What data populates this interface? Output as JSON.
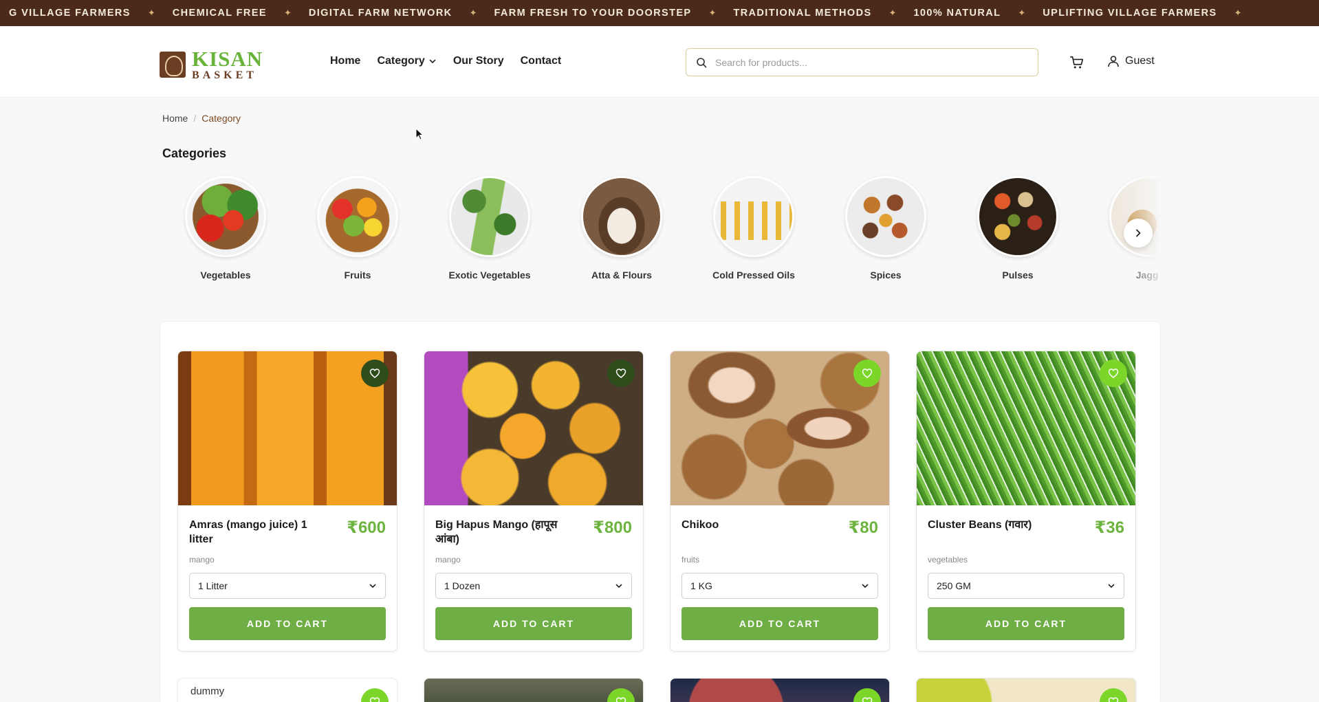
{
  "marquee": {
    "items": [
      "G VILLAGE FARMERS",
      "CHEMICAL FREE",
      "DIGITAL FARM NETWORK",
      "FARM FRESH TO YOUR DOORSTEP",
      "TRADITIONAL METHODS",
      "100% NATURAL",
      "UPLIFTING VILLAGE FARMERS"
    ],
    "separator": "✦"
  },
  "brand": {
    "line1": "KISAN",
    "line2": "BASKET"
  },
  "nav": {
    "home": "Home",
    "category": "Category",
    "story": "Our Story",
    "contact": "Contact"
  },
  "search": {
    "placeholder": "Search for products..."
  },
  "user": {
    "label": "Guest"
  },
  "breadcrumb": {
    "home": "Home",
    "sep": "/",
    "current": "Category"
  },
  "categories": {
    "title": "Categories",
    "items": [
      {
        "label": "Vegetables"
      },
      {
        "label": "Fruits"
      },
      {
        "label": "Exotic Vegetables"
      },
      {
        "label": "Atta & Flours"
      },
      {
        "label": "Cold Pressed Oils"
      },
      {
        "label": "Spices"
      },
      {
        "label": "Pulses"
      },
      {
        "label": "Jagge"
      }
    ]
  },
  "products": [
    {
      "name": "Amras (mango juice) 1 litter",
      "price": "₹600",
      "category": "mango",
      "variant": "1 Litter",
      "cta": "ADD TO CART",
      "wish_style": "dark"
    },
    {
      "name": "Big Hapus Mango (हापूस आंबा)",
      "price": "₹800",
      "category": "mango",
      "variant": "1 Dozen",
      "cta": "ADD TO CART",
      "wish_style": "dark"
    },
    {
      "name": "Chikoo",
      "price": "₹80",
      "category": "fruits",
      "variant": "1 KG",
      "cta": "ADD TO CART",
      "wish_style": "lime"
    },
    {
      "name": "Cluster Beans (गवार)",
      "price": "₹36",
      "category": "vegetables",
      "variant": "250 GM",
      "cta": "ADD TO CART",
      "wish_style": "lime"
    }
  ],
  "next_row": {
    "broken_image_alt": "dummy"
  },
  "colors": {
    "brand_green": "#6db33f",
    "button_green": "#6fae45",
    "brand_brown": "#4b2a1b",
    "wishlist_dark": "#2e4d1b",
    "wishlist_lime": "#7bd629"
  },
  "icons": {
    "search": "search-icon",
    "cart": "cart-icon",
    "user": "user-icon",
    "chevron": "chevron-down-icon",
    "heart": "heart-icon",
    "next": "chevron-right-icon"
  }
}
